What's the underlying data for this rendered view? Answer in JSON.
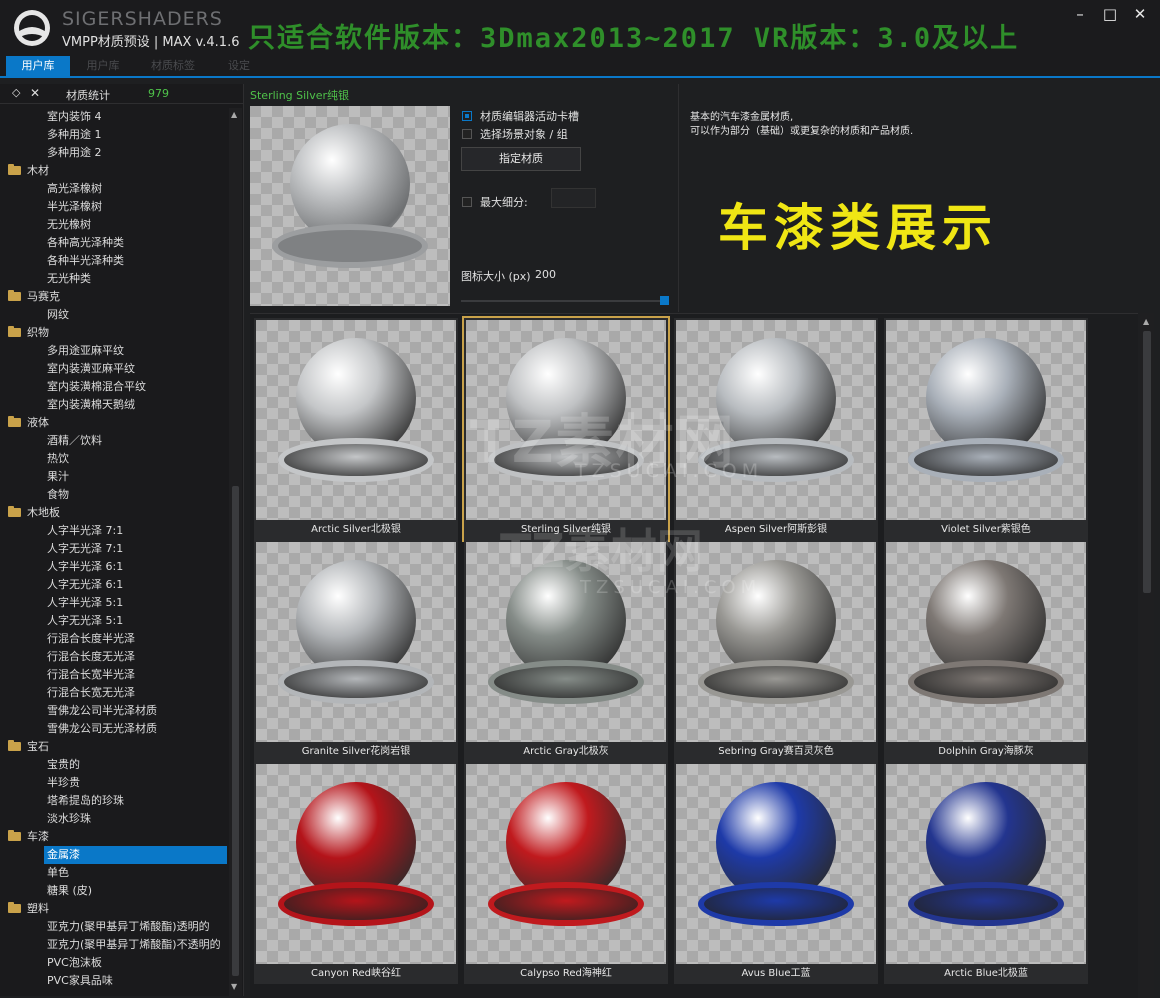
{
  "window": {
    "brand": "SIGERSHADERS",
    "app_title": "VMPP材质预设 | MAX v.4.1.6",
    "banner": "只适合软件版本：3Dmax2013~2017  VR版本：3.0及以上",
    "min_icon": "minimize-icon",
    "max_icon": "maximize-icon",
    "close_icon": "close-icon"
  },
  "tabs": [
    {
      "label": "用户库",
      "active": true
    },
    {
      "label": "用户库",
      "active": false
    },
    {
      "label": "材质标签",
      "active": false
    },
    {
      "label": "设定",
      "active": false
    }
  ],
  "sidebar": {
    "stats_label": "材质统计",
    "stats_count": "979",
    "tree": [
      {
        "label": "室内装饰 4",
        "type": "item"
      },
      {
        "label": "多种用途 1",
        "type": "item"
      },
      {
        "label": "多种用途 2",
        "type": "item"
      },
      {
        "label": "木材",
        "type": "cat"
      },
      {
        "label": "高光泽橡树",
        "type": "item"
      },
      {
        "label": "半光泽橡树",
        "type": "item"
      },
      {
        "label": "无光橡树",
        "type": "item"
      },
      {
        "label": "各种高光泽种类",
        "type": "item"
      },
      {
        "label": "各种半光泽种类",
        "type": "item"
      },
      {
        "label": "无光种类",
        "type": "item"
      },
      {
        "label": "马赛克",
        "type": "cat"
      },
      {
        "label": "网纹",
        "type": "item"
      },
      {
        "label": "织物",
        "type": "cat"
      },
      {
        "label": "多用途亚麻平纹",
        "type": "item"
      },
      {
        "label": "室内装潢亚麻平纹",
        "type": "item"
      },
      {
        "label": "室内装潢棉混合平纹",
        "type": "item"
      },
      {
        "label": "室内装潢棉天鹅绒",
        "type": "item"
      },
      {
        "label": "液体",
        "type": "cat"
      },
      {
        "label": "酒精／饮料",
        "type": "item"
      },
      {
        "label": "热饮",
        "type": "item"
      },
      {
        "label": "果汁",
        "type": "item"
      },
      {
        "label": "食物",
        "type": "item"
      },
      {
        "label": "木地板",
        "type": "cat"
      },
      {
        "label": "人字半光泽 7:1",
        "type": "item"
      },
      {
        "label": "人字无光泽 7:1",
        "type": "item"
      },
      {
        "label": "人字半光泽 6:1",
        "type": "item"
      },
      {
        "label": "人字无光泽 6:1",
        "type": "item"
      },
      {
        "label": "人字半光泽 5:1",
        "type": "item"
      },
      {
        "label": "人字无光泽 5:1",
        "type": "item"
      },
      {
        "label": "行混合长度半光泽",
        "type": "item"
      },
      {
        "label": "行混合长度无光泽",
        "type": "item"
      },
      {
        "label": "行混合长宽半光泽",
        "type": "item"
      },
      {
        "label": "行混合长宽无光泽",
        "type": "item"
      },
      {
        "label": "雪佛龙公司半光泽材质",
        "type": "item"
      },
      {
        "label": "雪佛龙公司无光泽材质",
        "type": "item"
      },
      {
        "label": "宝石",
        "type": "cat"
      },
      {
        "label": "宝贵的",
        "type": "item"
      },
      {
        "label": "半珍贵",
        "type": "item"
      },
      {
        "label": "塔希提岛的珍珠",
        "type": "item"
      },
      {
        "label": "淡水珍珠",
        "type": "item"
      },
      {
        "label": "车漆",
        "type": "cat"
      },
      {
        "label": "金属漆",
        "type": "item",
        "selected": true
      },
      {
        "label": "单色",
        "type": "item"
      },
      {
        "label": "糖果 (皮)",
        "type": "item"
      },
      {
        "label": "塑料",
        "type": "cat"
      },
      {
        "label": "亚克力(聚甲基异丁烯酸酯)透明的",
        "type": "item"
      },
      {
        "label": "亚克力(聚甲基异丁烯酸酯)不透明的",
        "type": "item"
      },
      {
        "label": "PVC泡沫板",
        "type": "item"
      },
      {
        "label": "PVC家具品味",
        "type": "item"
      }
    ]
  },
  "preview": {
    "material_name": "Sterling Silver纯银",
    "opt_slot_label": "材质编辑器活动卡槽",
    "opt_slot_checked": true,
    "opt_scene_label": "选择场景对象 / 组",
    "opt_scene_checked": false,
    "assign_button": "指定材质",
    "max_subdiv_label": "最大细分:",
    "max_subdiv_value": "",
    "icon_size_label": "图标大小 (px)",
    "icon_size_value": "200",
    "icon_size_fraction": 1.0,
    "description_line1": "基本的汽车漆金属材质,",
    "description_line2": "可以作为部分（基础）或更复杂的材质和产品材质.",
    "showcase_title": "车漆类展示"
  },
  "materials": [
    {
      "name": "Arctic Silver北极银",
      "color": "#c4c6c8"
    },
    {
      "name": "Sterling Silver纯银",
      "color": "#bfc1c3",
      "selected": true
    },
    {
      "name": "Aspen Silver阿斯彭银",
      "color": "#b8bcc0"
    },
    {
      "name": "Violet Silver紫银色",
      "color": "#a9b0b9"
    },
    {
      "name": "Granite Silver花岗岩银",
      "color": "#b3b6b9"
    },
    {
      "name": "Arctic Gray北极灰",
      "color": "#858c88"
    },
    {
      "name": "Sebring Gray赛百灵灰色",
      "color": "#999894"
    },
    {
      "name": "Dolphin Gray海豚灰",
      "color": "#7e7874"
    },
    {
      "name": "Canyon Red峡谷红",
      "color": "#b4141a"
    },
    {
      "name": "Calypso Red海神红",
      "color": "#c01a1e"
    },
    {
      "name": "Avus Blue工蓝",
      "color": "#1e3aa8"
    },
    {
      "name": "Arctic Blue北极蓝",
      "color": "#23358f"
    }
  ],
  "watermark": {
    "text1": "TZ素材网",
    "text2": "TZSUCAI.COM",
    "text3": "TZ素材网",
    "text4": "TZSUCAI.COM"
  },
  "colors": {
    "accent": "#0a78c8",
    "banner_green": "#2f8f2a",
    "showcase_yellow": "#f0e614",
    "selection_gold": "#c9a24a"
  }
}
